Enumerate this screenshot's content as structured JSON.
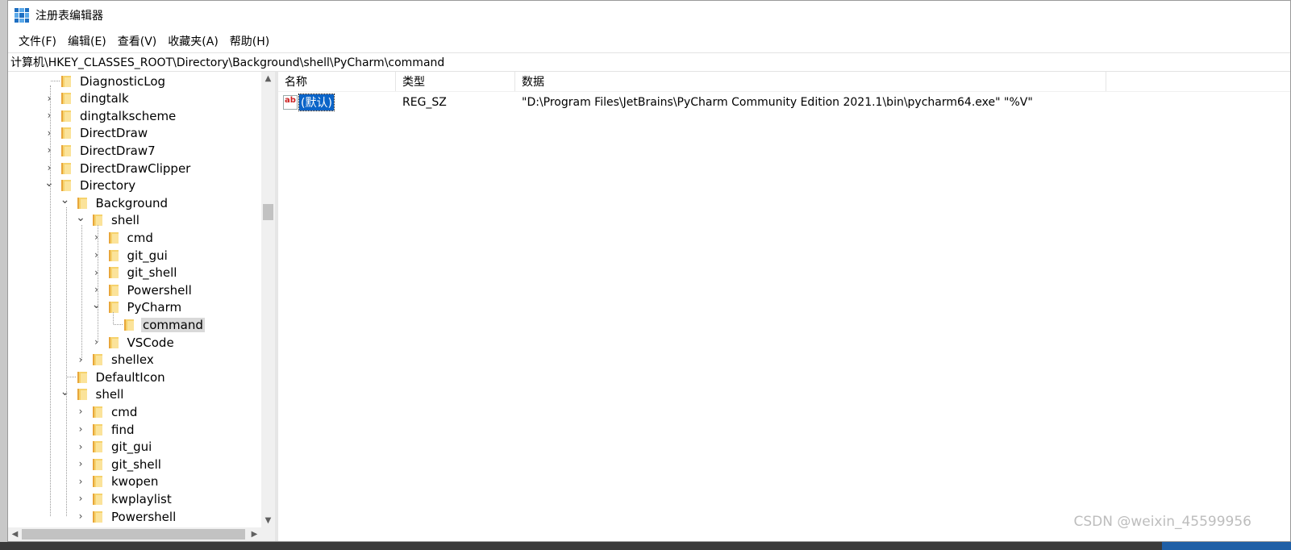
{
  "window": {
    "title": "注册表编辑器"
  },
  "menu": {
    "items": [
      "文件(F)",
      "编辑(E)",
      "查看(V)",
      "收藏夹(A)",
      "帮助(H)"
    ]
  },
  "address": "计算机\\HKEY_CLASSES_ROOT\\Directory\\Background\\shell\\PyCharm\\command",
  "tree": {
    "nodes": [
      {
        "label": "DiagnosticLog",
        "depth": 0,
        "state": "leaf"
      },
      {
        "label": "dingtalk",
        "depth": 0,
        "state": "collapsed"
      },
      {
        "label": "dingtalkscheme",
        "depth": 0,
        "state": "collapsed"
      },
      {
        "label": "DirectDraw",
        "depth": 0,
        "state": "collapsed"
      },
      {
        "label": "DirectDraw7",
        "depth": 0,
        "state": "collapsed"
      },
      {
        "label": "DirectDrawClipper",
        "depth": 0,
        "state": "collapsed"
      },
      {
        "label": "Directory",
        "depth": 0,
        "state": "expanded"
      },
      {
        "label": "Background",
        "depth": 1,
        "state": "expanded"
      },
      {
        "label": "shell",
        "depth": 2,
        "state": "expanded"
      },
      {
        "label": "cmd",
        "depth": 3,
        "state": "collapsed"
      },
      {
        "label": "git_gui",
        "depth": 3,
        "state": "collapsed"
      },
      {
        "label": "git_shell",
        "depth": 3,
        "state": "collapsed"
      },
      {
        "label": "Powershell",
        "depth": 3,
        "state": "collapsed"
      },
      {
        "label": "PyCharm",
        "depth": 3,
        "state": "expanded"
      },
      {
        "label": "command",
        "depth": 4,
        "state": "leaf",
        "selected": true
      },
      {
        "label": "VSCode",
        "depth": 3,
        "state": "collapsed"
      },
      {
        "label": "shellex",
        "depth": 2,
        "state": "collapsed"
      },
      {
        "label": "DefaultIcon",
        "depth": 1,
        "state": "leaf"
      },
      {
        "label": "shell",
        "depth": 1,
        "state": "expanded"
      },
      {
        "label": "cmd",
        "depth": 2,
        "state": "collapsed"
      },
      {
        "label": "find",
        "depth": 2,
        "state": "collapsed"
      },
      {
        "label": "git_gui",
        "depth": 2,
        "state": "collapsed"
      },
      {
        "label": "git_shell",
        "depth": 2,
        "state": "collapsed"
      },
      {
        "label": "kwopen",
        "depth": 2,
        "state": "collapsed"
      },
      {
        "label": "kwplaylist",
        "depth": 2,
        "state": "collapsed"
      },
      {
        "label": "Powershell",
        "depth": 2,
        "state": "collapsed"
      }
    ]
  },
  "list": {
    "columns": {
      "name": "名称",
      "type": "类型",
      "data": "数据"
    },
    "rows": [
      {
        "icon": "string-value-icon",
        "icon_text": "ab",
        "name": "(默认)",
        "type": "REG_SZ",
        "data": "\"D:\\Program Files\\JetBrains\\PyCharm Community Edition 2021.1\\bin\\pycharm64.exe\" \"%V\""
      }
    ]
  },
  "watermark": "CSDN @weixin_45599956"
}
